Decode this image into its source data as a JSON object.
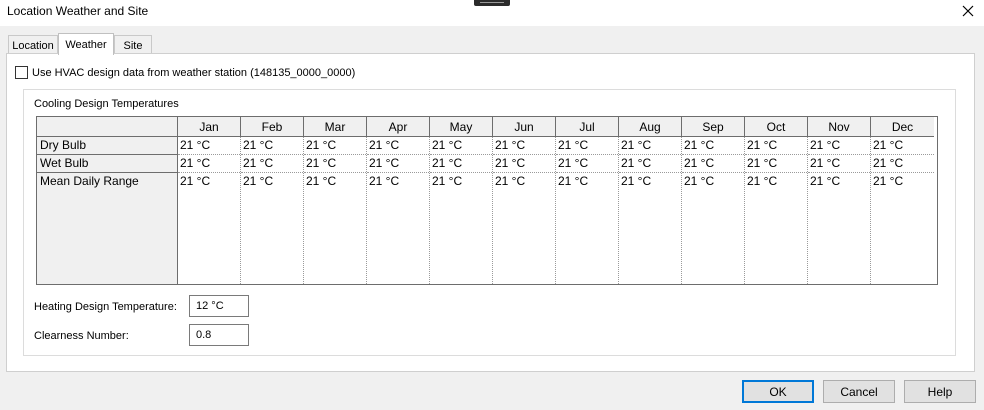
{
  "window": {
    "title": "Location Weather and Site"
  },
  "tabs": [
    {
      "label": "Location"
    },
    {
      "label": "Weather"
    },
    {
      "label": "Site"
    }
  ],
  "hvac_checkbox": {
    "label": "Use HVAC design data from weather station (148135_0000_0000)",
    "checked": false
  },
  "cooling": {
    "group_label": "Cooling Design Temperatures",
    "months": [
      "Jan",
      "Feb",
      "Mar",
      "Apr",
      "May",
      "Jun",
      "Jul",
      "Aug",
      "Sep",
      "Oct",
      "Nov",
      "Dec"
    ],
    "rows": [
      {
        "label": "Dry Bulb",
        "values": [
          "21 °C",
          "21 °C",
          "21 °C",
          "21 °C",
          "21 °C",
          "21 °C",
          "21 °C",
          "21 °C",
          "21 °C",
          "21 °C",
          "21 °C",
          "21 °C"
        ]
      },
      {
        "label": "Wet Bulb",
        "values": [
          "21 °C",
          "21 °C",
          "21 °C",
          "21 °C",
          "21 °C",
          "21 °C",
          "21 °C",
          "21 °C",
          "21 °C",
          "21 °C",
          "21 °C",
          "21 °C"
        ]
      },
      {
        "label": "Mean Daily Range",
        "values": [
          "21 °C",
          "21 °C",
          "21 °C",
          "21 °C",
          "21 °C",
          "21 °C",
          "21 °C",
          "21 °C",
          "21 °C",
          "21 °C",
          "21 °C",
          "21 °C"
        ]
      }
    ]
  },
  "heating": {
    "label": "Heating Design Temperature:",
    "value": "12 °C"
  },
  "clearness": {
    "label": "Clearness Number:",
    "value": "0.8"
  },
  "buttons": {
    "ok": "OK",
    "cancel": "Cancel",
    "help": "Help"
  },
  "icons": {
    "close": "close-icon",
    "drag": "drag-grip-icon"
  },
  "colors": {
    "accent": "#0078d7",
    "dialog_bg": "#f0f0f0"
  }
}
